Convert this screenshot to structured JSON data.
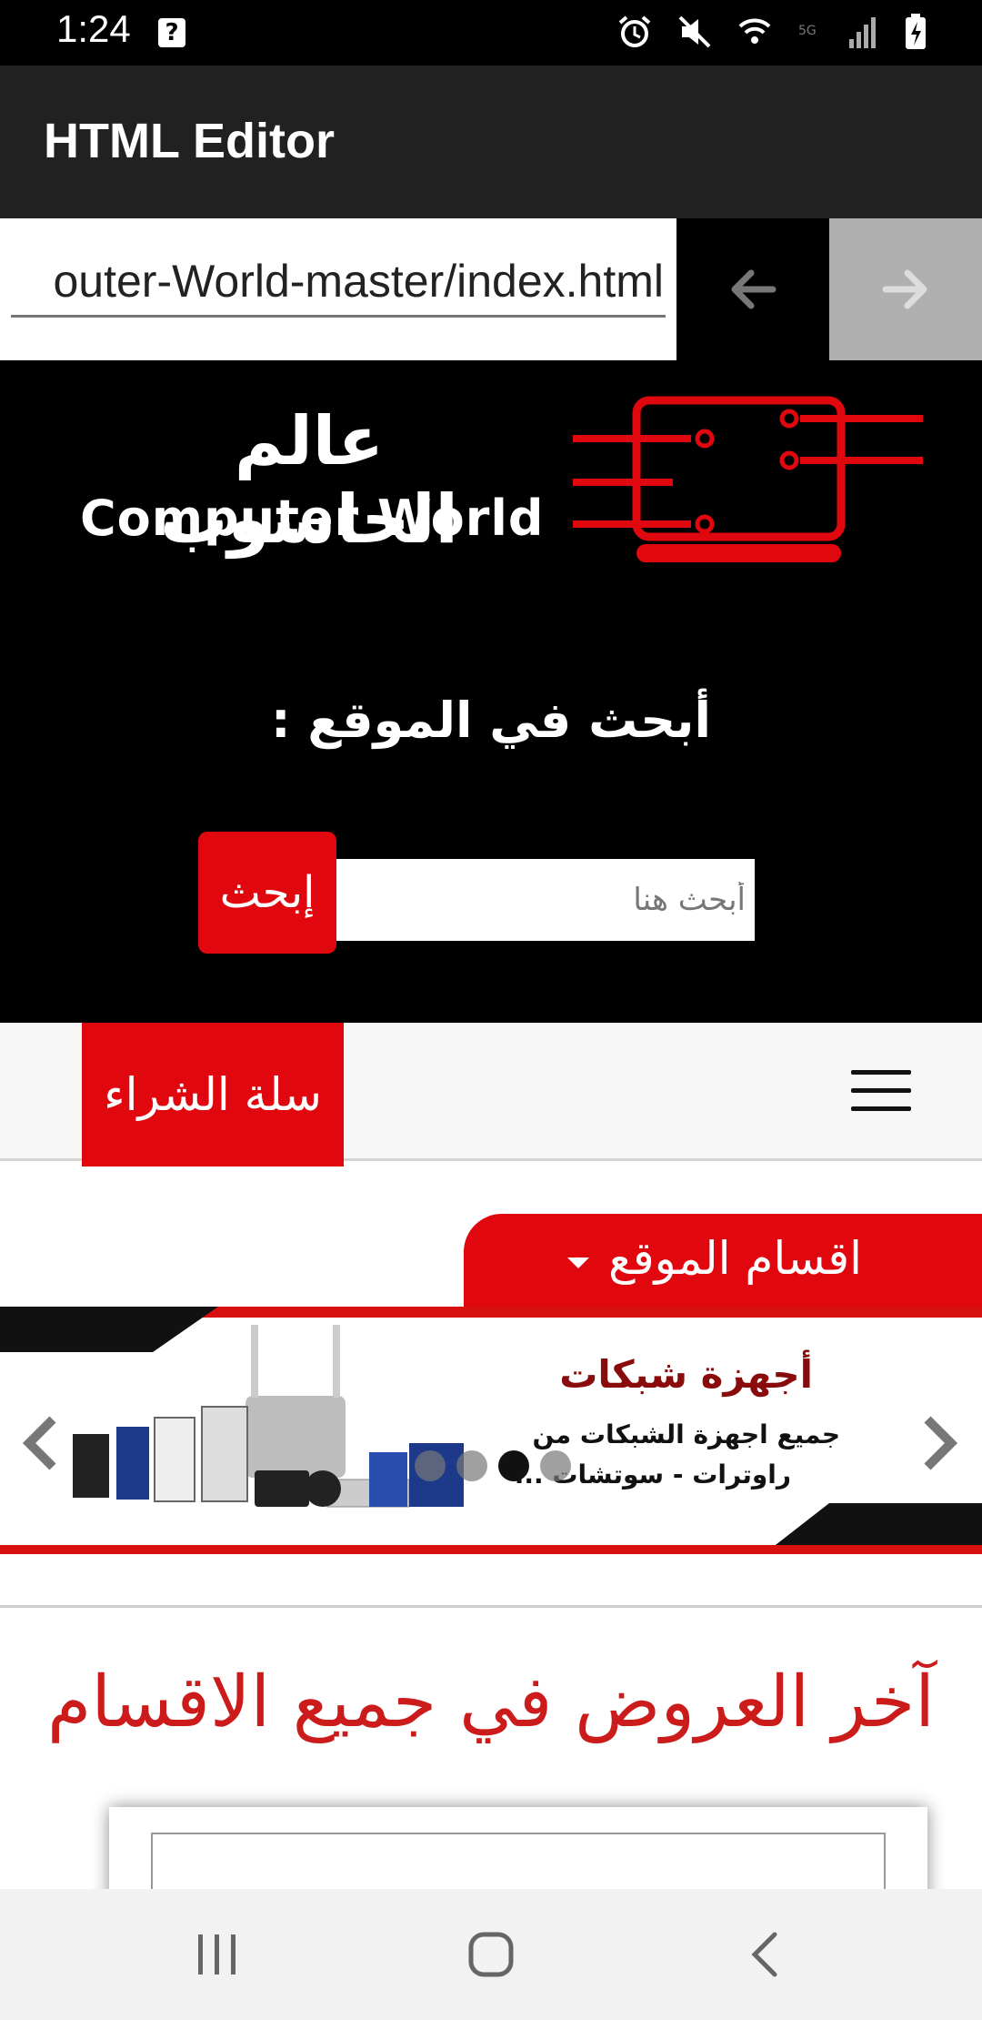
{
  "status_bar": {
    "time": "1:24",
    "notice_icon": "question-box-icon",
    "icons": [
      "alarm-icon",
      "mute-icon",
      "wifi-icon",
      "no-sim-icon",
      "signal-icon",
      "battery-charging-icon"
    ]
  },
  "app_bar": {
    "title": "HTML Editor"
  },
  "url_bar": {
    "value": "outer-World-master/index.html",
    "back_icon": "arrow-left-icon",
    "forward_icon": "arrow-right-icon"
  },
  "site": {
    "logo_ar": "عالم الحاسوب",
    "logo_en": "Computer World",
    "search_heading": "أبحث في الموقع :",
    "search_placeholder": "أبحث هنا",
    "search_button": "إبحث",
    "cart_button": "سلة الشراء",
    "menu_icon": "hamburger-menu-icon",
    "categories_tab": "اقسام الموقع",
    "carousel": {
      "title": "أجهزة شبكات",
      "line1": "جميع اجهزة الشبكات من",
      "line2": "راوترات - سوتشات ...",
      "active_slide": 3,
      "slide_count": 4
    },
    "offers_heading": "آخر العروض في جميع الاقسام"
  },
  "system_nav": {
    "recent": "recent-apps-icon",
    "home": "home-icon",
    "back": "back-icon"
  },
  "colors": {
    "brand_red": "#e0080e",
    "heading_red": "#cc1b1b",
    "app_bar": "#212121"
  }
}
